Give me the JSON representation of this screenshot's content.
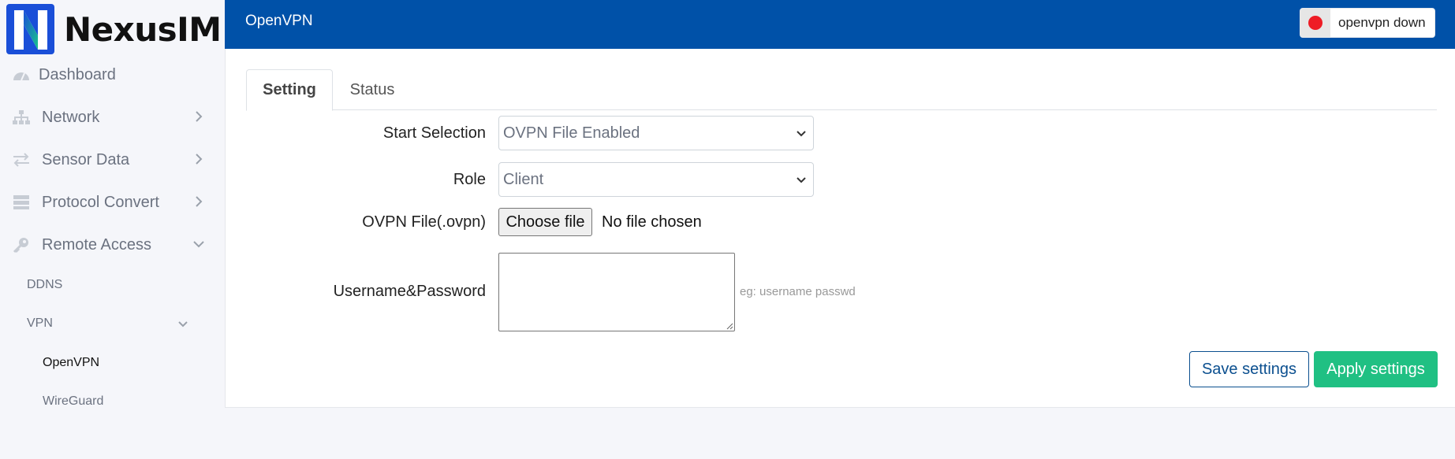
{
  "brand": {
    "name": "NexusIM"
  },
  "sidebar": {
    "items": [
      {
        "label": "Dashboard",
        "icon": "dashboard-icon"
      },
      {
        "label": "Network",
        "icon": "network-icon"
      },
      {
        "label": "Sensor Data",
        "icon": "exchange-icon"
      },
      {
        "label": "Protocol Convert",
        "icon": "server-icon"
      },
      {
        "label": "Remote Access",
        "icon": "key-icon"
      }
    ],
    "remote_access_sub": {
      "ddns": "DDNS",
      "vpn": "VPN",
      "vpn_sub": {
        "openvpn": "OpenVPN",
        "wireguard": "WireGuard"
      }
    }
  },
  "header": {
    "title": "OpenVPN",
    "status": {
      "text": "openvpn down",
      "color": "#ee1c25"
    }
  },
  "tabs": [
    {
      "label": "Setting",
      "active": true
    },
    {
      "label": "Status",
      "active": false
    }
  ],
  "form": {
    "start_selection": {
      "label": "Start Selection",
      "value": "OVPN File Enabled"
    },
    "role": {
      "label": "Role",
      "value": "Client"
    },
    "ovpn_file": {
      "label": "OVPN File(.ovpn)",
      "button": "Choose file",
      "status": "No file chosen"
    },
    "credentials": {
      "label": "Username&Password",
      "value": "",
      "hint": "eg: username passwd"
    }
  },
  "actions": {
    "save": "Save settings",
    "apply": "Apply settings"
  },
  "colors": {
    "header": "#0051a8",
    "apply": "#20c083",
    "save_border": "#0b4f8f",
    "logo_blue": "#1a4fd8",
    "logo_green": "#17c48a"
  }
}
